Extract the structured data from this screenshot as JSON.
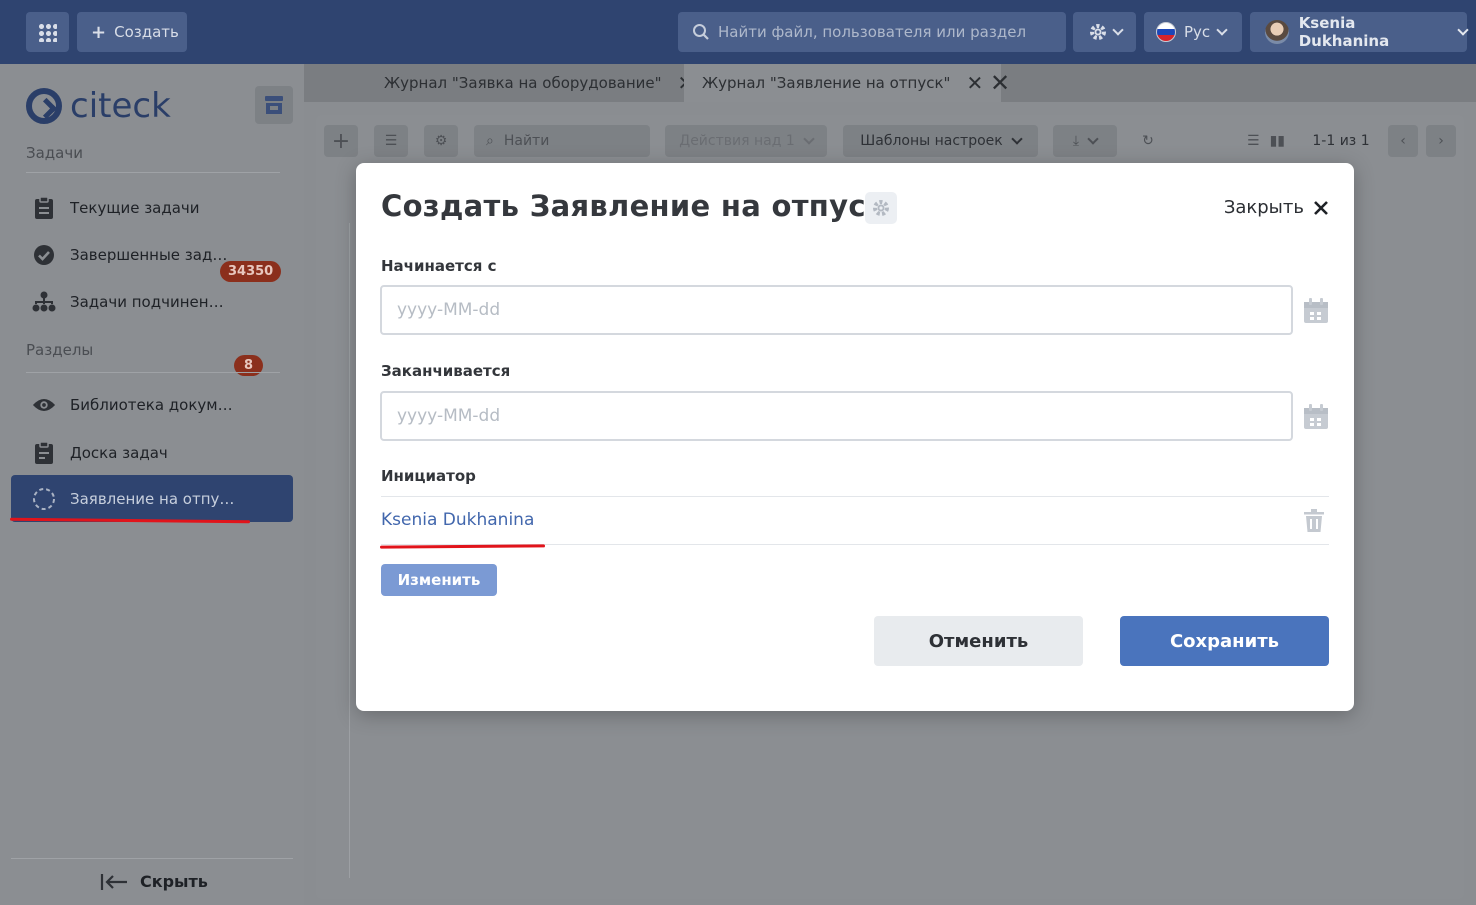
{
  "header": {
    "create_label": "Создать",
    "search_placeholder": "Найти файл, пользователя или раздел",
    "language": "Рус",
    "user_name": "Ksenia Dukhanina"
  },
  "sidebar": {
    "logo_text": "citeck",
    "section_tasks": "Задачи",
    "section_sections": "Разделы",
    "items": [
      {
        "label": "Текущие задачи",
        "badge": "34350",
        "icon": "clipboard-icon"
      },
      {
        "label": "Завершенные задачи",
        "icon": "check-circle-icon"
      },
      {
        "label": "Задачи подчиненных",
        "badge": "8",
        "icon": "org-chart-icon"
      },
      {
        "label": "Библиотека документов",
        "icon": "eye-icon"
      },
      {
        "label": "Доска задач",
        "icon": "clipboard-icon"
      },
      {
        "label": "Заявление на отпуск",
        "icon": "dashed-circle-icon",
        "active": true
      }
    ],
    "hide_label": "Скрыть"
  },
  "tabs": [
    {
      "label": "Журнал \"Заявка на оборудование\""
    },
    {
      "label": "Журнал \"Заявление на отпуск\"",
      "active": true
    }
  ],
  "toolbar": {
    "search_placeholder": "Найти",
    "actions_label": "Действия над 1",
    "templates_label": "Шаблоны настроек",
    "pagination": "1-1 из 1"
  },
  "modal": {
    "title": "Создать Заявление на отпуск",
    "close_label": "Закрыть",
    "start_label": "Начинается с",
    "start_placeholder": "yyyy-MM-dd",
    "end_label": "Заканчивается",
    "end_placeholder": "yyyy-MM-dd",
    "initiator_label": "Инициатор",
    "initiator_value": "Ksenia Dukhanina",
    "change_label": "Изменить",
    "cancel_label": "Отменить",
    "save_label": "Сохранить"
  },
  "colors": {
    "header_bg": "#2f4470",
    "primary": "#4a74bd",
    "badge": "#8b2f1c",
    "annotation": "#e1141b"
  }
}
